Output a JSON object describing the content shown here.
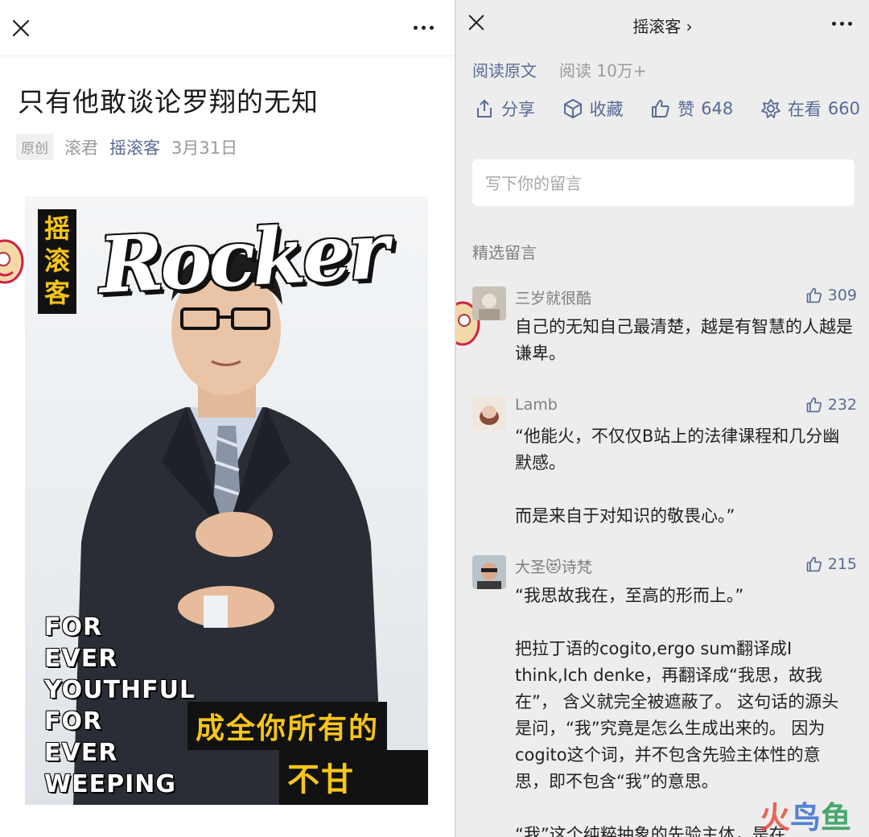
{
  "left": {
    "article": {
      "title": "只有他敢谈论罗翔的无知",
      "original_tag": "原创",
      "author": "滚君",
      "account": "摇滚客",
      "date": "3月31日"
    },
    "cover": {
      "badge_chars": [
        "摇",
        "滚",
        "客"
      ],
      "logo": "Rocker",
      "forever_lines": [
        "FOR",
        "EVER",
        "YOUTHFUL",
        "FOR",
        "EVER",
        "WEEPING"
      ],
      "slogan_line1": "成全你所有的",
      "slogan_line2": "不甘心！"
    }
  },
  "right": {
    "header": {
      "account_title": "摇滚客"
    },
    "read_original": "阅读原文",
    "read_count": "阅读 10万+",
    "actions": {
      "share": "分享",
      "favorite": "收藏",
      "like_label": "赞",
      "like_count": "648",
      "watching_label": "在看",
      "watching_count": "660"
    },
    "comment_placeholder": "写下你的留言",
    "section_title": "精选留言",
    "comments": [
      {
        "name": "三岁就很酷",
        "likes": "309",
        "text": "自己的无知自己最清楚，越是有智慧的人越是谦卑。"
      },
      {
        "name": "Lamb",
        "likes": "232",
        "text": "“他能火，不仅仅B站上的法律课程和几分幽默感。\n\n而是来自于对知识的敬畏心。”"
      },
      {
        "name": "大圣😻诗梵",
        "likes": "215",
        "text": "“我思故我在，至高的形而上。”\n\n把拉丁语的cogito,ergo sum翻译成I think,Ich denke，再翻译成“我思，故我在”， 含义就完全被遮蔽了。 这句话的源头是问，“我”究竟是怎么生成出来的。 因为cogito这个词，并不包含先验主体性的意思，即不包含“我”的意思。\n\n“我”这个纯粹抽象的先验主体，是在"
      }
    ],
    "watermark": {
      "c1": "火",
      "c2": "鸟",
      "c3": "鱼"
    }
  },
  "colors": {
    "link_blue": "#576b95",
    "cover_yellow": "#f5c518",
    "right_bg": "#ededed"
  }
}
